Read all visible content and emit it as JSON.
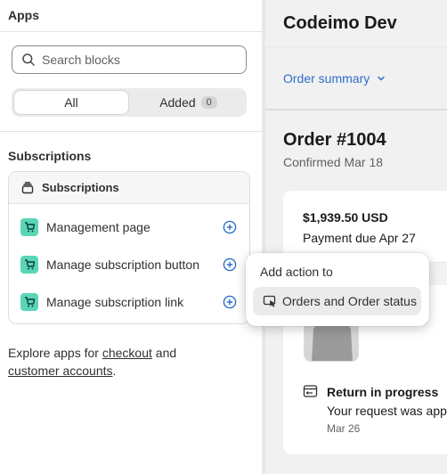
{
  "sidebar": {
    "title": "Apps",
    "search": {
      "placeholder": "Search blocks"
    },
    "filter": {
      "all_label": "All",
      "added_label": "Added",
      "added_count": "0"
    },
    "section_heading": "Subscriptions",
    "app_card": {
      "title": "Subscriptions",
      "blocks": [
        {
          "label": "Management page"
        },
        {
          "label": "Manage subscription button"
        },
        {
          "label": "Manage subscription link"
        }
      ]
    },
    "explore": {
      "prefix": "Explore apps for ",
      "link1": "checkout",
      "middle": " and",
      "link2": "customer accounts",
      "suffix": "."
    }
  },
  "preview": {
    "store_name": "Codeimo Dev",
    "order_summary_label": "Order summary",
    "order_number": "Order #1004",
    "confirmed": "Confirmed Mar 18",
    "amount": "$1,939.50 USD",
    "payment_due": "Payment due Apr 27",
    "return_title": "Return in progress",
    "return_desc": "Your request was approved",
    "return_date": "Mar 26"
  },
  "popover": {
    "title": "Add action to",
    "item_label": "Orders and Order status"
  },
  "colors": {
    "accent": "#2c6ecb",
    "app_icon": "#5ad6b6"
  }
}
